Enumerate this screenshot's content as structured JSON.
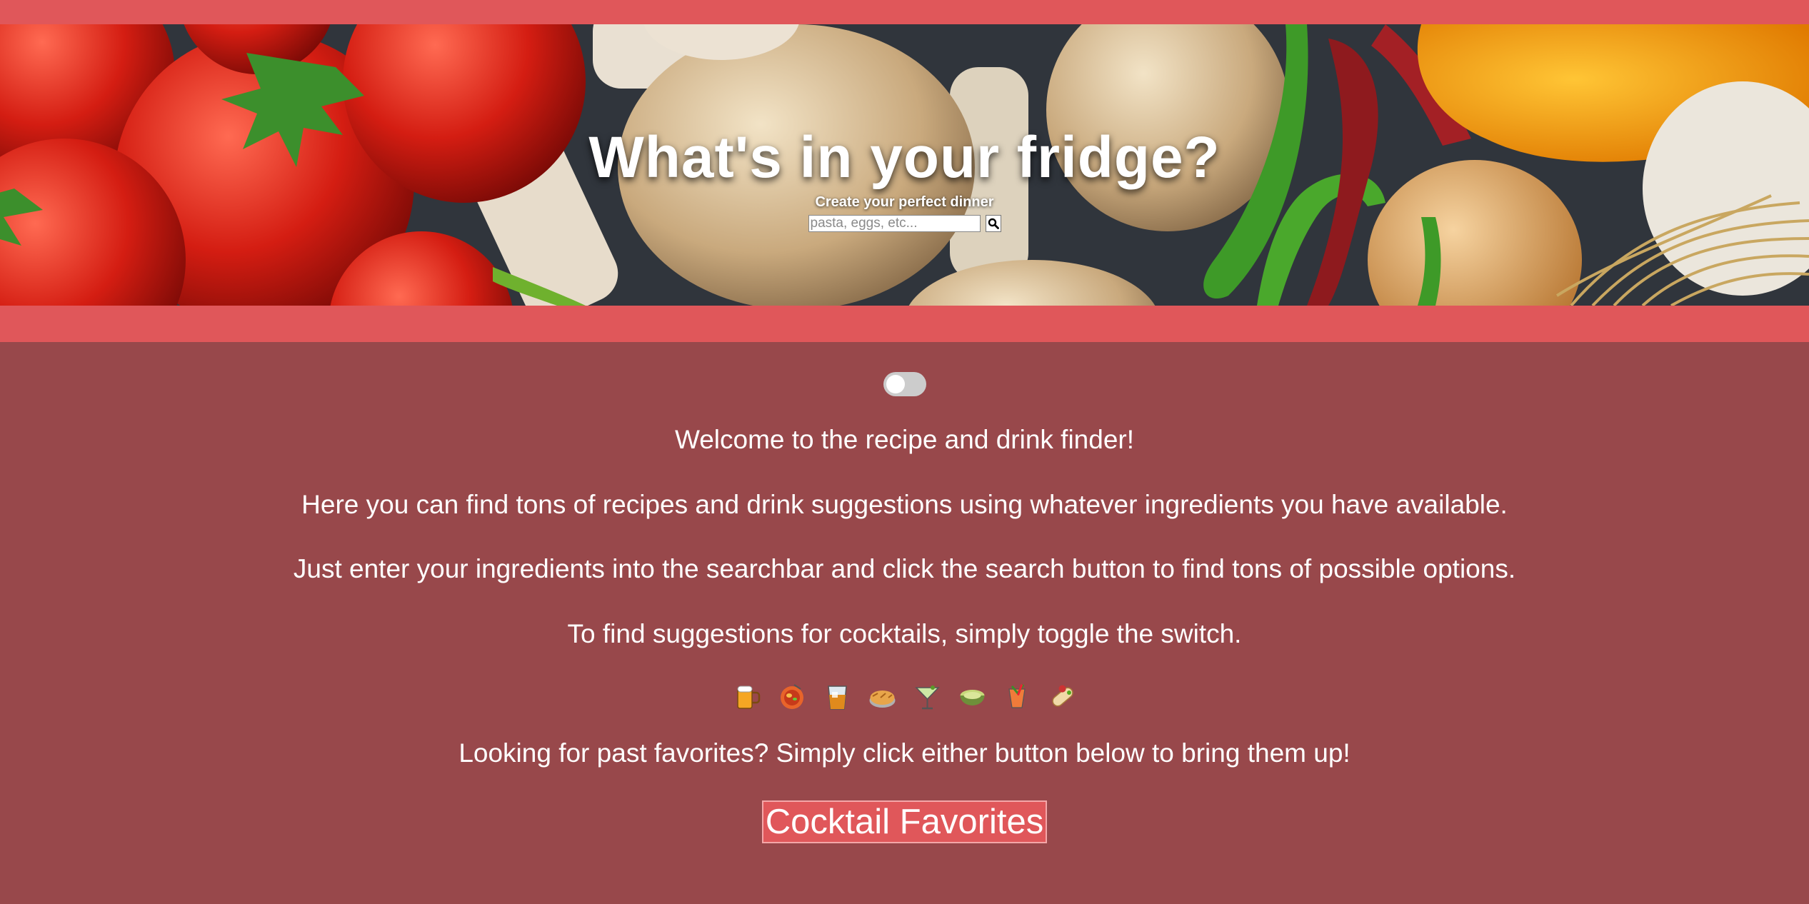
{
  "hero": {
    "title": "What's in your fridge?",
    "subtitle": "Create your perfect dinner",
    "search_placeholder": "pasta, eggs, etc...",
    "search_icon": "magnifying-glass-icon"
  },
  "toggle": {
    "state": "off"
  },
  "intro": {
    "welcome": "Welcome to the recipe and drink finder!",
    "line2": "Here you can find tons of recipes and drink suggestions using whatever ingredients you have available.",
    "line3": "Just enter your ingredients into the searchbar and click the search button to find tons of possible options.",
    "line4": "To find suggestions for cocktails, simply toggle the switch."
  },
  "emojis": [
    "beer-mug-icon",
    "steaming-bowl-icon",
    "tumbler-glass-icon",
    "pie-icon",
    "cocktail-glass-icon",
    "green-bowl-icon",
    "tropical-drink-icon",
    "burrito-icon"
  ],
  "favorites": {
    "prompt": "Looking for past favorites? Simply click either button below to bring them up!",
    "cocktail_button": "Cocktail Favorites"
  },
  "colors": {
    "band": "#e0575a",
    "page_background": "#98484b",
    "text": "#ffffff"
  }
}
